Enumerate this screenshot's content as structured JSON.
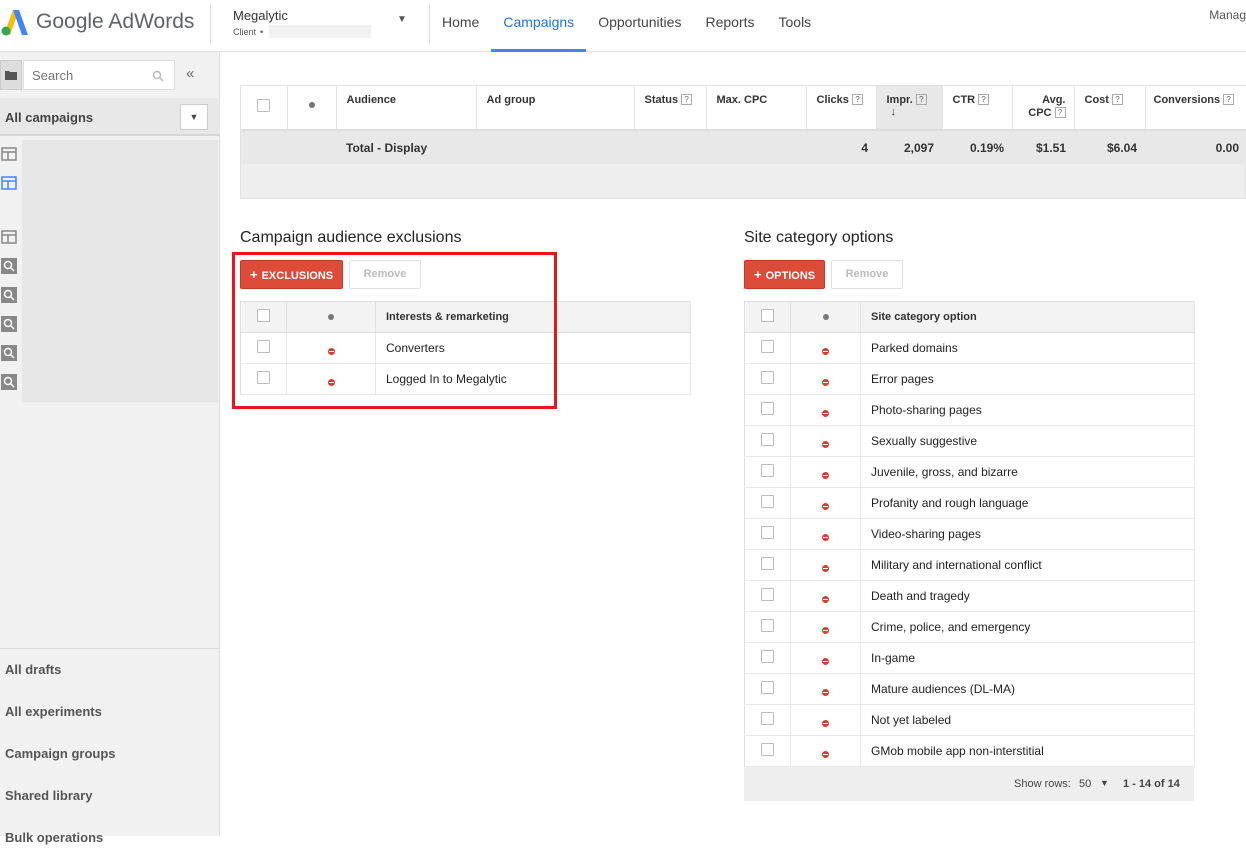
{
  "header": {
    "logo_text": "Google AdWords",
    "account_name": "Megalytic",
    "account_sub": "Client",
    "nav": [
      {
        "label": "Home"
      },
      {
        "label": "Campaigns"
      },
      {
        "label": "Opportunities"
      },
      {
        "label": "Reports"
      },
      {
        "label": "Tools"
      }
    ],
    "active_nav": "Campaigns",
    "manage_label": "Manag"
  },
  "sidebar": {
    "search_placeholder": "Search",
    "collapse_glyph": "«",
    "all_campaigns_label": "All campaigns",
    "bottom_links": [
      {
        "label": "All drafts"
      },
      {
        "label": "All experiments"
      },
      {
        "label": "Campaign groups"
      },
      {
        "label": "Shared library"
      },
      {
        "label": "Bulk operations"
      }
    ]
  },
  "stats_table": {
    "columns": [
      {
        "label": "Audience"
      },
      {
        "label": "Ad group"
      },
      {
        "label": "Status"
      },
      {
        "label": "Max. CPC"
      },
      {
        "label": "Clicks"
      },
      {
        "label": "Impr."
      },
      {
        "label": "CTR"
      },
      {
        "label": "Avg. CPC"
      },
      {
        "label": "Cost"
      },
      {
        "label": "Conversions"
      }
    ],
    "total": {
      "label": "Total - Display",
      "clicks": "4",
      "impr": "2,097",
      "ctr": "0.19%",
      "avg_cpc": "$1.51",
      "cost": "$6.04",
      "conversions": "0.00"
    }
  },
  "audience_exclusions": {
    "title": "Campaign audience exclusions",
    "add_button": "EXCLUSIONS",
    "remove_button": "Remove",
    "column_header": "Interests & remarketing",
    "rows": [
      "Converters",
      "Logged In to Megalytic"
    ]
  },
  "site_categories": {
    "title": "Site category options",
    "add_button": "OPTIONS",
    "remove_button": "Remove",
    "column_header": "Site category option",
    "rows": [
      "Parked domains",
      "Error pages",
      "Photo-sharing pages",
      "Sexually suggestive",
      "Juvenile, gross, and bizarre",
      "Profanity and rough language",
      "Video-sharing pages",
      "Military and international conflict",
      "Death and tragedy",
      "Crime, police, and emergency",
      "In-game",
      "Mature audiences (DL-MA)",
      "Not yet labeled",
      "GMob mobile app non-interstitial"
    ],
    "show_rows_label": "Show rows:",
    "show_rows_value": "50",
    "pagination": "1 - 14 of 14"
  },
  "colors": {
    "accent_blue": "#4285f4",
    "primary_red": "#dd4b39",
    "highlight_box": "#e8161c"
  }
}
